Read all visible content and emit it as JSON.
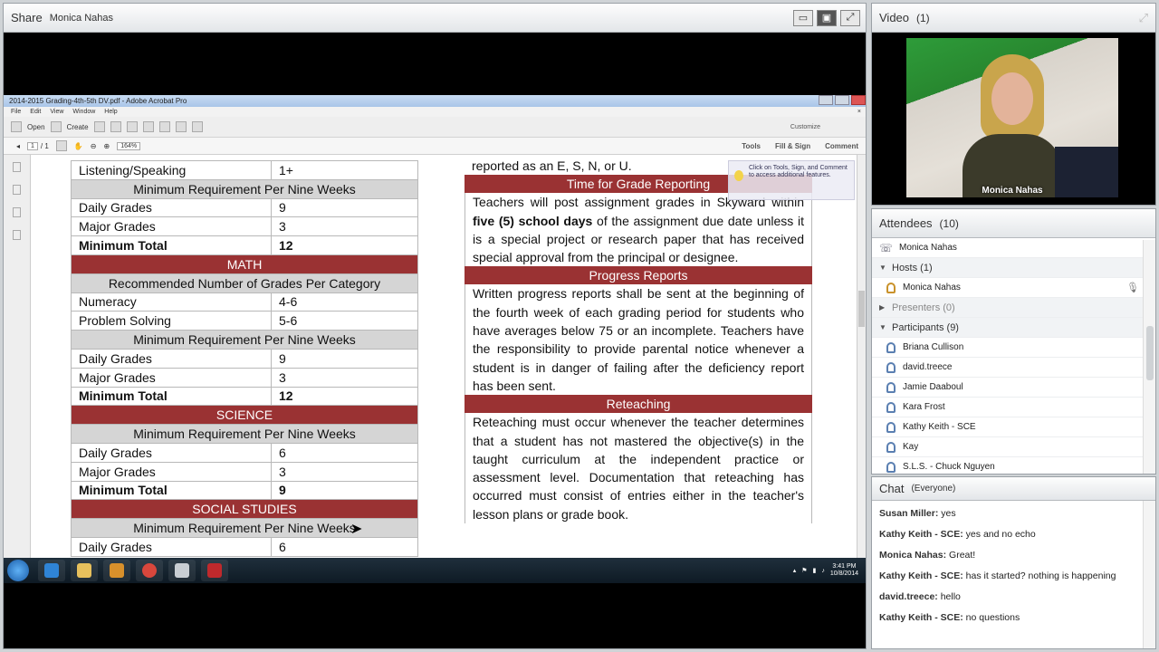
{
  "share": {
    "title": "Share",
    "presenter": "Monica Nahas"
  },
  "acrobat": {
    "window_title": "2014-2015 Grading-4th-5th DV.pdf - Adobe Acrobat Pro",
    "menu": [
      "File",
      "Edit",
      "View",
      "Window",
      "Help"
    ],
    "open_label": "Open",
    "create_label": "Create",
    "customize_label": "Customize",
    "page_current": "1",
    "page_total": "/ 1",
    "zoom": "164%",
    "tools_label": "Tools",
    "fill_sign_label": "Fill & Sign",
    "comment_label": "Comment",
    "tooltip": "Click on Tools, Sign, and Comment to access additional features."
  },
  "left_table": [
    {
      "type": "plain",
      "label": "Listening/Speaking",
      "value": "1+"
    },
    {
      "type": "gray",
      "label": "Minimum Requirement Per Nine Weeks"
    },
    {
      "type": "plain",
      "label": "Daily Grades",
      "value": "9"
    },
    {
      "type": "plain",
      "label": "Major Grades",
      "value": "3"
    },
    {
      "type": "bold",
      "label": "Minimum Total",
      "value": "12"
    },
    {
      "type": "red",
      "label": "MATH"
    },
    {
      "type": "gray",
      "label": "Recommended Number of Grades Per Category"
    },
    {
      "type": "plain",
      "label": "Numeracy",
      "value": "4-6"
    },
    {
      "type": "plain",
      "label": "Problem Solving",
      "value": "5-6"
    },
    {
      "type": "gray",
      "label": "Minimum Requirement Per Nine Weeks"
    },
    {
      "type": "plain",
      "label": "Daily Grades",
      "value": "9"
    },
    {
      "type": "plain",
      "label": "Major Grades",
      "value": "3"
    },
    {
      "type": "bold",
      "label": "Minimum Total",
      "value": "12"
    },
    {
      "type": "red",
      "label": "SCIENCE"
    },
    {
      "type": "gray",
      "label": "Minimum Requirement Per Nine Weeks"
    },
    {
      "type": "plain",
      "label": "Daily Grades",
      "value": "6"
    },
    {
      "type": "plain",
      "label": "Major Grades",
      "value": "3"
    },
    {
      "type": "bold",
      "label": "Minimum Total",
      "value": "9"
    },
    {
      "type": "red",
      "label": "SOCIAL STUDIES"
    },
    {
      "type": "gray",
      "label": "Minimum Requirement Per Nine Weeks"
    },
    {
      "type": "plain",
      "label": "Daily Grades",
      "value": "6"
    }
  ],
  "right_col": {
    "intro": "reported as an E, S, N, or U.",
    "h1": "Time for Grade Reporting",
    "p1_a": "Teachers will post assignment grades in Skyward within ",
    "p1_b": "five (5) school days",
    "p1_c": " of the assignment due date unless it is a special project or research paper that has received special approval from the principal or designee.",
    "h2": "Progress Reports",
    "p2": "Written progress reports shall be sent at the beginning of the fourth week of each grading period for students who have averages below 75 or an incomplete. Teachers have the responsibility to provide parental notice whenever a student is in danger of failing after the deficiency report has been sent.",
    "h3": "Reteaching",
    "p3": "Reteaching must occur whenever the teacher determines that a student has not mastered the objective(s) in the taught curriculum at the independent practice or assessment level. Documentation that reteaching has occurred must consist of entries either in the teacher's lesson plans or grade book."
  },
  "taskbar": {
    "time": "3:41 PM",
    "date": "10/8/2014"
  },
  "video": {
    "title": "Video",
    "count": "(1)",
    "caption": "Monica Nahas"
  },
  "attendees": {
    "title": "Attendees",
    "count": "(10)",
    "me": "Monica Nahas",
    "hosts_label": "Hosts (1)",
    "host": "Monica Nahas",
    "presenters_label": "Presenters (0)",
    "participants_label": "Participants (9)",
    "participants": [
      "Briana Cullison",
      "david.treece",
      "Jamie Daaboul",
      "Kara Frost",
      "Kathy Keith - SCE",
      "Kay",
      "S.L.S. - Chuck Nguyen"
    ]
  },
  "chat": {
    "title": "Chat",
    "audience": "(Everyone)",
    "messages": [
      {
        "from": "Susan Miller:",
        "text": " yes"
      },
      {
        "from": "Kathy Keith - SCE:",
        "text": " yes   and no echo"
      },
      {
        "from": "Monica Nahas:",
        "text": " Great!"
      },
      {
        "from": "Kathy Keith - SCE:",
        "text": " has it started?  nothing is happening"
      },
      {
        "from": "david.treece:",
        "text": " hello"
      },
      {
        "from": "Kathy Keith - SCE:",
        "text": " no questions"
      }
    ]
  }
}
